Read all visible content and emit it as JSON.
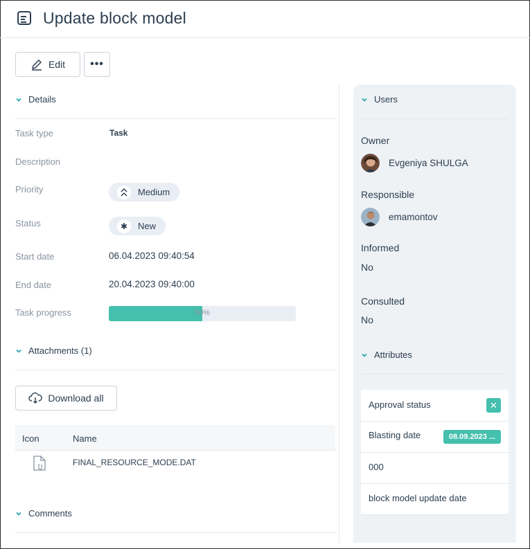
{
  "header": {
    "title": "Update block model",
    "icon": "document-icon"
  },
  "toolbar": {
    "edit_label": "Edit",
    "more_label": "•••"
  },
  "details": {
    "section_label": "Details",
    "fields": {
      "task_type": {
        "label": "Task type",
        "value": "Task"
      },
      "description": {
        "label": "Description",
        "value": ""
      },
      "priority": {
        "label": "Priority",
        "value": "Medium",
        "icon": "chevrons-up-icon"
      },
      "status": {
        "label": "Status",
        "value": "New",
        "icon": "asterisk-icon"
      },
      "start_date": {
        "label": "Start date",
        "value": "06.04.2023 09:40:54"
      },
      "end_date": {
        "label": "End date",
        "value": "20.04.2023 09:40:00"
      },
      "progress": {
        "label": "Task progress",
        "value": 0.5,
        "text": "50%"
      }
    }
  },
  "attachments": {
    "section_label": "Attachments (1)",
    "download_label": "Download all",
    "columns": [
      "Icon",
      "Name"
    ],
    "files": [
      {
        "name": "FINAL_RESOURCE_MODE.DAT",
        "icon": "file-attachment-icon"
      }
    ]
  },
  "comments": {
    "section_label": "Comments"
  },
  "users": {
    "section_label": "Users",
    "owner": {
      "label": "Owner",
      "name": "Evgeniya SHULGA"
    },
    "responsible": {
      "label": "Responsible",
      "name": "emamontov"
    },
    "informed": {
      "label": "Informed",
      "value": "No"
    },
    "consulted": {
      "label": "Consulted",
      "value": "No"
    }
  },
  "attributes": {
    "section_label": "Attributes",
    "items": [
      {
        "label": "Approval status",
        "badge": "✕"
      },
      {
        "label": "Blasting date",
        "badge": "08.09.2023 ..."
      },
      {
        "label": "000"
      },
      {
        "label": "block model update date"
      }
    ]
  },
  "colors": {
    "accent": "#45bfae",
    "chevron": "#1aa0a8",
    "sidebar_bg": "#eef2f5",
    "text": "#2c3e50",
    "muted": "#8a94a0"
  }
}
